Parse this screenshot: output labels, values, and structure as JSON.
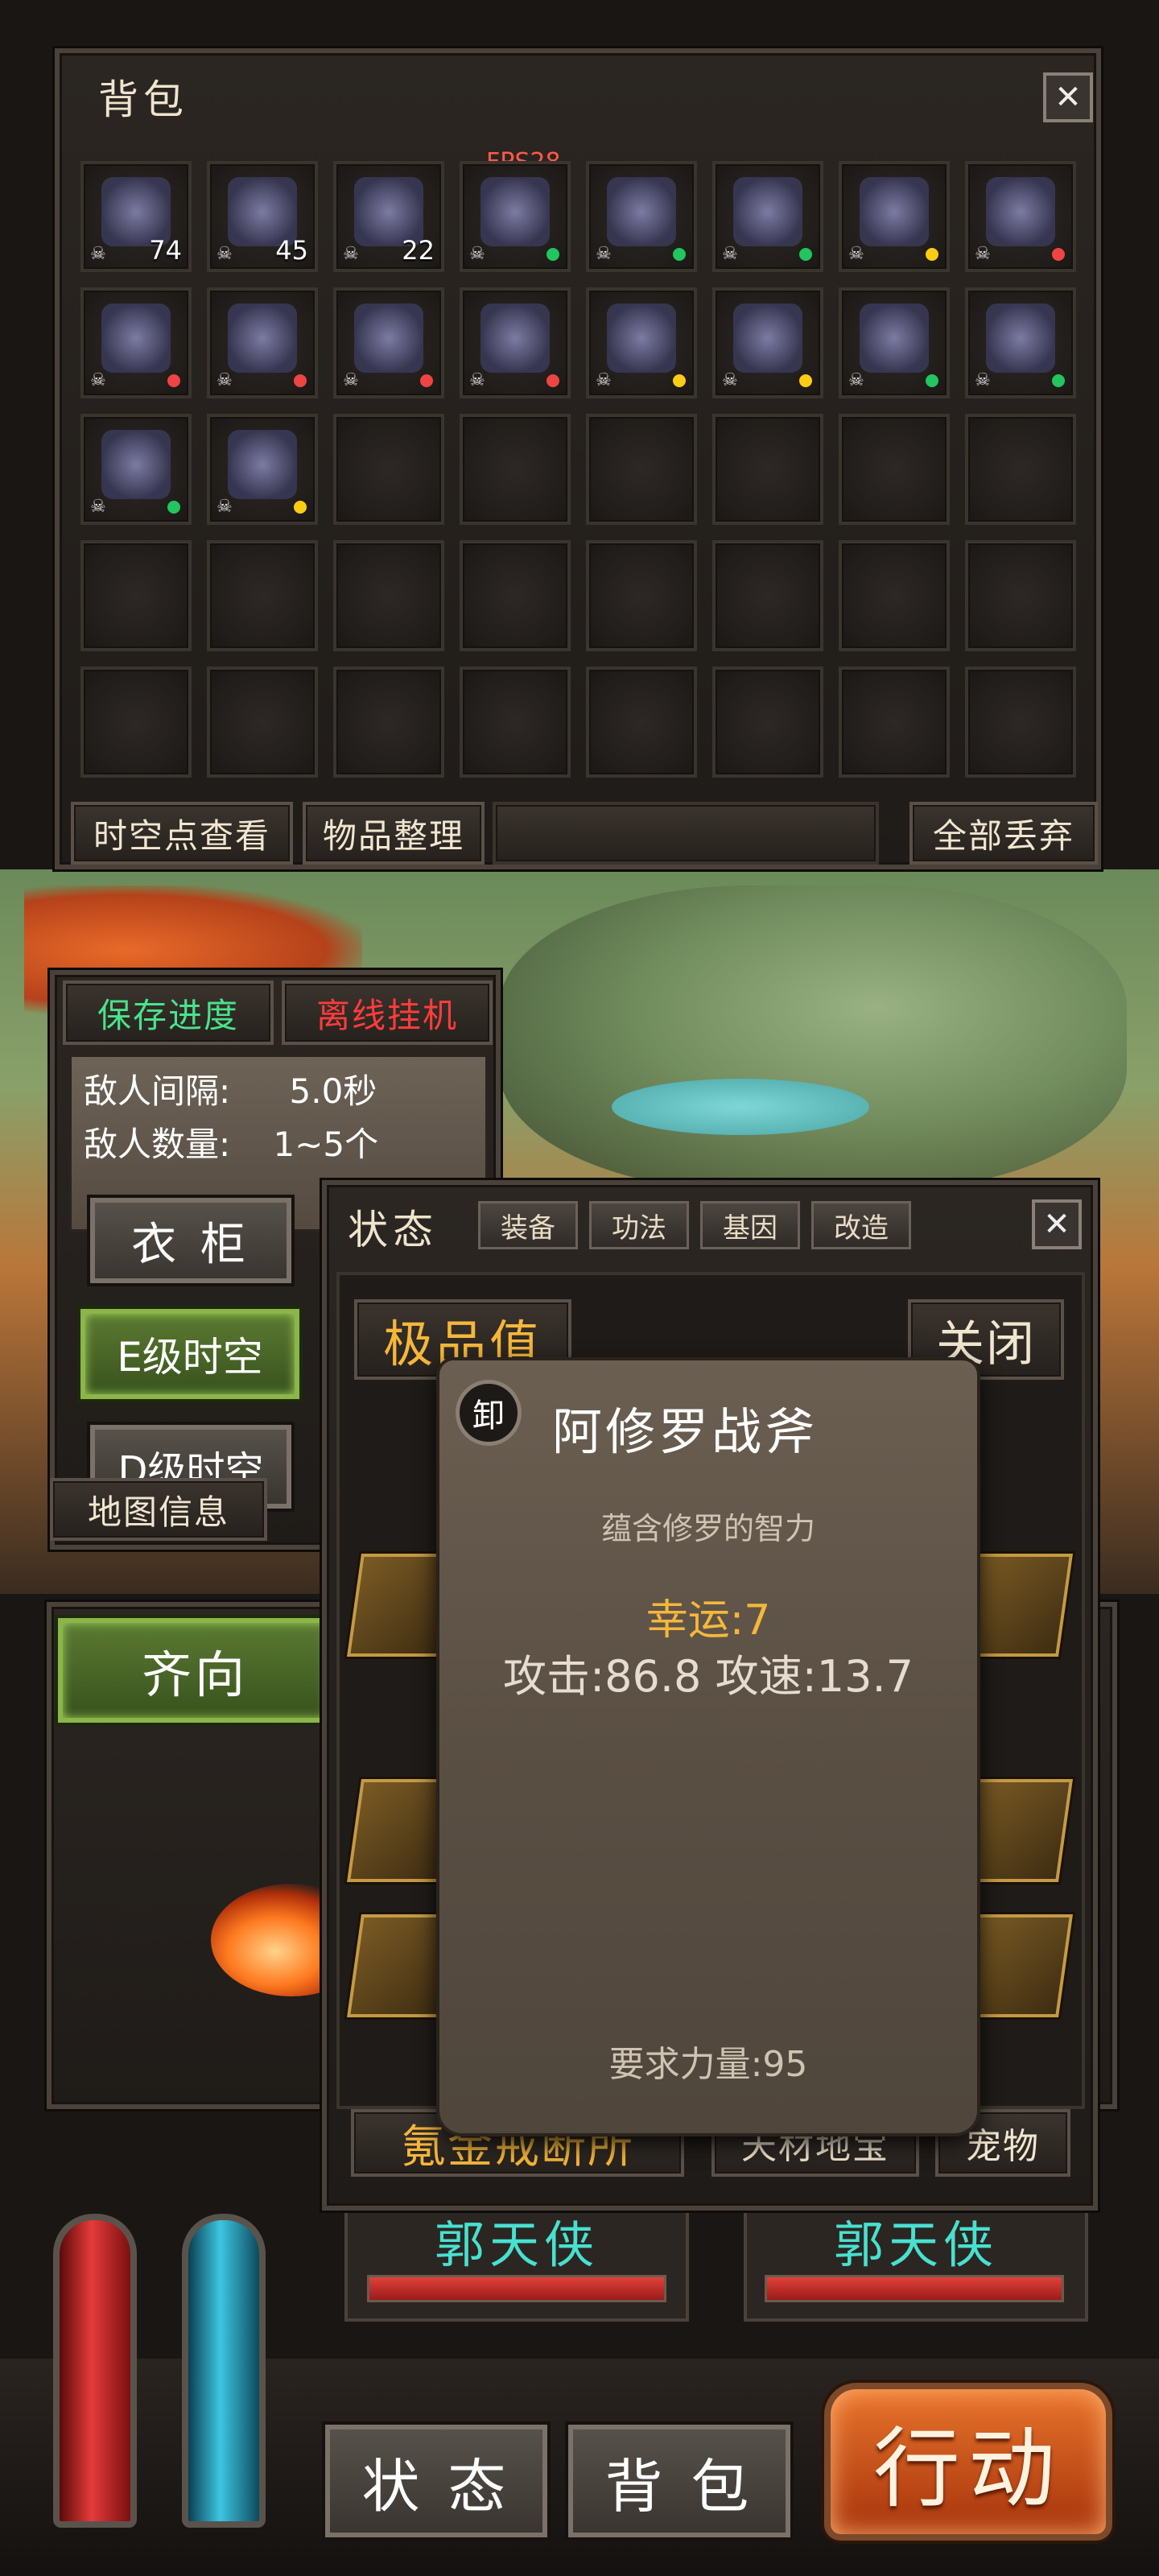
{
  "inventory": {
    "title": "背包",
    "fps": "FPS28",
    "items": [
      {
        "name": "potion-box-icon",
        "qty": "74",
        "dot": ""
      },
      {
        "name": "bottle-gourd-icon",
        "qty": "45",
        "dot": ""
      },
      {
        "name": "camera-icon",
        "qty": "22",
        "dot": ""
      },
      {
        "name": "blue-orb-icon",
        "qty": "",
        "dot": "#22c55e"
      },
      {
        "name": "blue-crystal-icon",
        "qty": "",
        "dot": "#22c55e"
      },
      {
        "name": "armor-icon",
        "qty": "",
        "dot": "#22c55e"
      },
      {
        "name": "gold-amulet-icon",
        "qty": "",
        "dot": "#facc15"
      },
      {
        "name": "curved-blade-icon",
        "qty": "",
        "dot": "#ef4444"
      },
      {
        "name": "white-sword-icon",
        "qty": "",
        "dot": "#ef4444"
      },
      {
        "name": "dragon-blade-icon",
        "qty": "",
        "dot": "#ef4444"
      },
      {
        "name": "broadsword-icon",
        "qty": "",
        "dot": "#ef4444"
      },
      {
        "name": "guandao-icon",
        "qty": "",
        "dot": "#ef4444"
      },
      {
        "name": "spear-icon",
        "qty": "",
        "dot": "#facc15"
      },
      {
        "name": "spear-icon-2",
        "qty": "",
        "dot": "#facc15"
      },
      {
        "name": "staff-icon",
        "qty": "",
        "dot": "#22c55e"
      },
      {
        "name": "long-spear-icon",
        "qty": "",
        "dot": "#22c55e"
      },
      {
        "name": "red-belt-icon",
        "qty": "",
        "dot": "#22c55e"
      },
      {
        "name": "boots-icon",
        "qty": "",
        "dot": "#facc15"
      }
    ],
    "buttons": {
      "check_points": "时空点查看",
      "sort": "物品整理",
      "discard_all": "全部丢弃"
    }
  },
  "left_panel": {
    "save": "保存进度",
    "offline": "离线挂机",
    "stats": [
      {
        "label": "敌人间隔:",
        "value": "5.0秒"
      },
      {
        "label": "敌人数量:",
        "value": "1~5个"
      }
    ],
    "wardrobe": "衣 柜",
    "e_level": "E级时空",
    "d_level": "D级时空",
    "map_info": "地图信息",
    "qixiang": "齐向"
  },
  "status_panel": {
    "title": "状态",
    "tabs": [
      "装备",
      "功法",
      "基因",
      "改造"
    ],
    "top_value_label": "极品值",
    "close_label": "关闭",
    "bottom_tabs": [
      "氪金戒断所",
      "天材地宝",
      "宠物"
    ]
  },
  "tooltip": {
    "unequip": "卸",
    "item_name": "阿修罗战斧",
    "description": "蕴含修罗的智力",
    "luck": "幸运:7",
    "attack": "攻击:86.8 攻速:13.7",
    "requirement": "要求力量:95"
  },
  "battle": {
    "enemy_left": "郭天侠",
    "enemy_right": "郭天侠",
    "hp_left": 1.0,
    "hp_right": 1.0
  },
  "bottom_bar": {
    "status": "状 态",
    "bag": "背 包",
    "action": "行动"
  }
}
